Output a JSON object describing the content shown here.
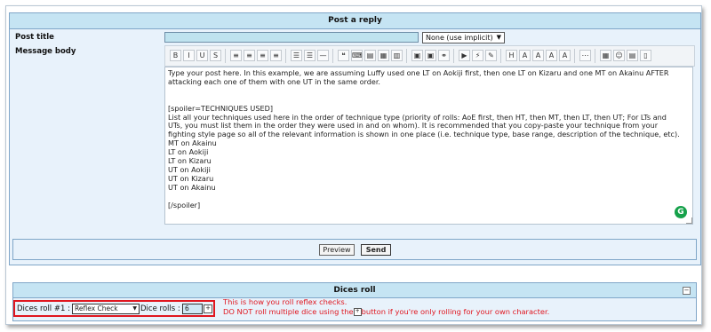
{
  "post_reply": {
    "header": "Post a reply",
    "post_title_label": "Post title",
    "message_body_label": "Message body",
    "icon_select": "None (use implicit)",
    "message_text": "Type your post here. In this example, we are assuming Luffy used one LT on Aokiji first, then one LT on Kizaru and one MT on Akainu AFTER\nattacking each one of them with one UT in the same order.\n\n\n[spoiler=TECHNIQUES USED]\nList all your techniques used here in the order of technique type (priority of rolls: AoE first, then HT, then MT, then LT, then UT; For LTs and\nUTs, you must list them in the order they were used in and on whom). It is recommended that you copy-paste your technique from your\nfighting style page so all of the relevant information is shown in one place (i.e. technique type, base range, description of the technique, etc).\nMT on Akainu\nLT on Aokiji\nLT on Kizaru\nUT on Aokiji\nUT on Kizaru\nUT on Akainu\n\n[/spoiler]",
    "preview_label": "Preview",
    "send_label": "Send",
    "grammarly_letter": "G"
  },
  "toolbar": {
    "buttons": [
      {
        "icon": "bold-icon",
        "glyph": "B"
      },
      {
        "icon": "italic-icon",
        "glyph": "I"
      },
      {
        "icon": "underline-icon",
        "glyph": "U"
      },
      {
        "icon": "strike-icon",
        "glyph": "S"
      },
      {
        "icon": "align-left-icon",
        "glyph": "≡"
      },
      {
        "icon": "align-center-icon",
        "glyph": "≡"
      },
      {
        "icon": "align-right-icon",
        "glyph": "≡"
      },
      {
        "icon": "justify-icon",
        "glyph": "≡"
      },
      {
        "icon": "bullet-list-icon",
        "glyph": "☰"
      },
      {
        "icon": "numbered-list-icon",
        "glyph": "☰"
      },
      {
        "icon": "horizontal-rule-icon",
        "glyph": "—"
      },
      {
        "icon": "quote-icon",
        "glyph": "❝"
      },
      {
        "icon": "code-icon",
        "glyph": "⌨"
      },
      {
        "icon": "spoiler-icon",
        "glyph": "▤"
      },
      {
        "icon": "hide-icon",
        "glyph": "▦"
      },
      {
        "icon": "table-icon",
        "glyph": "▥"
      },
      {
        "icon": "image-icon",
        "glyph": "▣"
      },
      {
        "icon": "gallery-icon",
        "glyph": "▣"
      },
      {
        "icon": "link-icon",
        "glyph": "⚭"
      },
      {
        "icon": "youtube-icon",
        "glyph": "▶"
      },
      {
        "icon": "flash-icon",
        "glyph": "⚡"
      },
      {
        "icon": "eraser-icon",
        "glyph": "✎"
      },
      {
        "icon": "heading-icon",
        "glyph": "H"
      },
      {
        "icon": "font-size-icon",
        "glyph": "A"
      },
      {
        "icon": "font-face-icon",
        "glyph": "A"
      },
      {
        "icon": "color-icon",
        "glyph": "A"
      },
      {
        "icon": "clear-format-icon",
        "glyph": "A"
      },
      {
        "icon": "separator-icon",
        "glyph": "⋯"
      },
      {
        "icon": "date-icon",
        "glyph": "▦"
      },
      {
        "icon": "emoticon-icon",
        "glyph": "☺"
      },
      {
        "icon": "paste-icon",
        "glyph": "▤"
      },
      {
        "icon": "source-icon",
        "glyph": "▯"
      }
    ]
  },
  "dice": {
    "header": "Dices roll",
    "roll_label": "Dices roll #1 :",
    "roll_type": "Reflex Check",
    "rolls_label": "Dice rolls :",
    "rolls_value": "6",
    "note_line1": "This is how you roll reflex checks.",
    "note_line2_before": "DO NOT roll multiple dice using the",
    "note_line2_after": "button if you're only rolling for your own character."
  },
  "colors": {
    "highlight_red": "#e0161f",
    "header_blue": "#c5e4f3",
    "panel_bg": "#e8f2fb",
    "grammarly_green": "#15a14a"
  }
}
